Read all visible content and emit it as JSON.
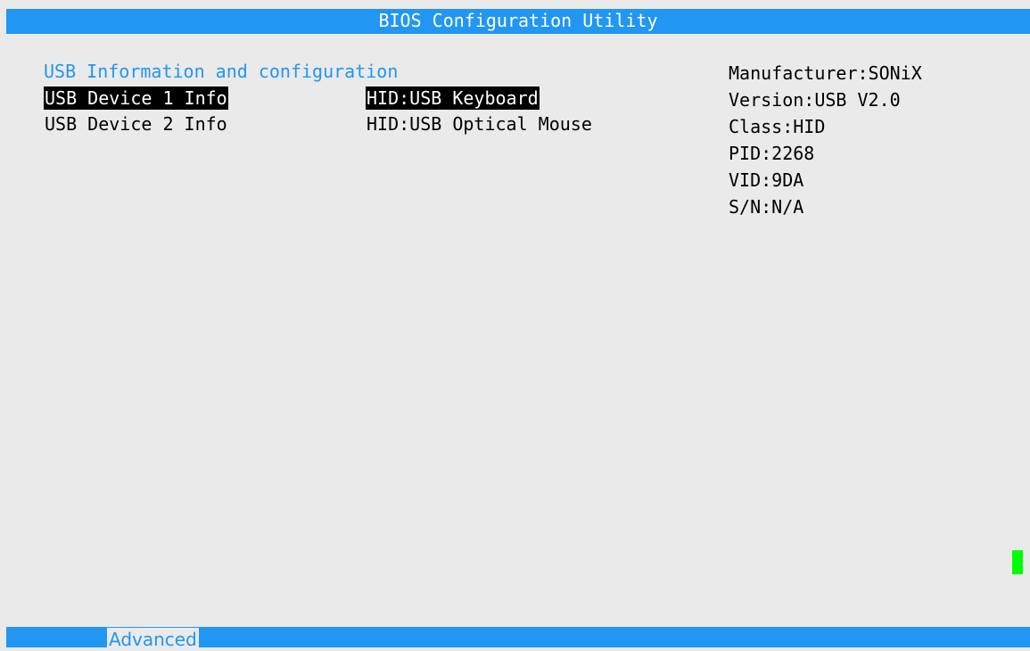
{
  "title_bar": {
    "title": "BIOS Configuration Utility"
  },
  "section": {
    "title": "USB Information and configuration"
  },
  "devices": [
    {
      "label": "USB Device 1 Info",
      "hid": "HID:USB Keyboard",
      "selected": true
    },
    {
      "label": "USB Device 2 Info",
      "hid": "HID:USB Optical Mouse",
      "selected": false
    }
  ],
  "info_panel": {
    "lines": [
      "Manufacturer:SONiX",
      "Version:USB V2.0",
      "Class:HID",
      "PID:2268",
      "VID:9DA",
      "S/N:N/A"
    ]
  },
  "bottom_bar": {
    "active_tab": "Advanced"
  },
  "colors": {
    "accent_blue": "#2196f3",
    "background": "#eaeaea",
    "selection_bg": "#000000",
    "cursor_green": "#00ff00"
  }
}
